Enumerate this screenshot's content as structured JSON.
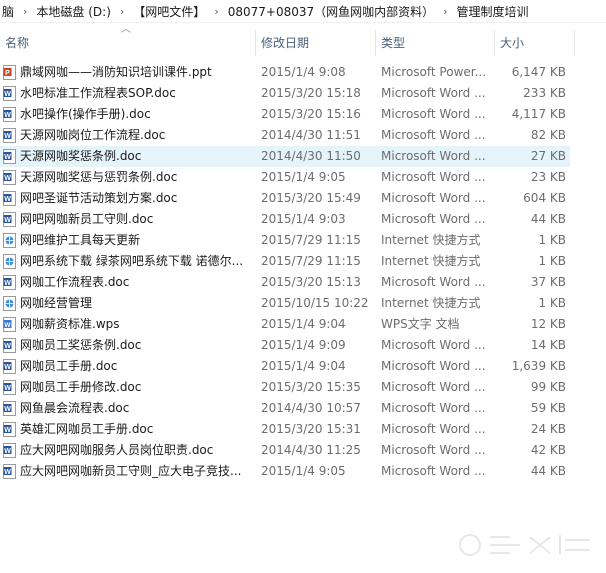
{
  "breadcrumb": [
    "脑",
    "本地磁盘 (D:)",
    "【网吧文件】",
    "08077+08037（网鱼网咖内部资料）",
    "管理制度培训"
  ],
  "columns": {
    "name": "名称",
    "date": "修改日期",
    "type": "类型",
    "size": "大小"
  },
  "colors": {
    "selected_row": "#e5f3fb",
    "header_text": "#4c607a",
    "meta_text": "#6d6d6d"
  },
  "files": [
    {
      "name": "鼎域网咖——消防知识培训课件.ppt",
      "date": "2015/1/4 9:08",
      "type": "Microsoft Power...",
      "size": "6,147 KB",
      "icon": "ppt-file-icon"
    },
    {
      "name": "水吧标准工作流程表SOP.doc",
      "date": "2015/3/20 15:18",
      "type": "Microsoft Word ...",
      "size": "233 KB",
      "icon": "word-file-icon"
    },
    {
      "name": "水吧操作(操作手册).doc",
      "date": "2015/3/20 15:16",
      "type": "Microsoft Word ...",
      "size": "4,117 KB",
      "icon": "word-file-icon"
    },
    {
      "name": "天源网咖岗位工作流程.doc",
      "date": "2014/4/30 11:51",
      "type": "Microsoft Word ...",
      "size": "82 KB",
      "icon": "word-file-icon"
    },
    {
      "name": "天源网咖奖惩条例.doc",
      "date": "2014/4/30 11:50",
      "type": "Microsoft Word ...",
      "size": "27 KB",
      "icon": "word-file-icon",
      "selected": true
    },
    {
      "name": "天源网咖奖惩与惩罚条例.doc",
      "date": "2015/1/4 9:05",
      "type": "Microsoft Word ...",
      "size": "23 KB",
      "icon": "word-file-icon"
    },
    {
      "name": "网吧圣诞节活动策划方案.doc",
      "date": "2015/3/20 15:49",
      "type": "Microsoft Word ...",
      "size": "604 KB",
      "icon": "word-file-icon"
    },
    {
      "name": "网吧网咖新员工守则.doc",
      "date": "2015/1/4 9:03",
      "type": "Microsoft Word ...",
      "size": "44 KB",
      "icon": "word-file-icon"
    },
    {
      "name": "网吧维护工具每天更新",
      "date": "2015/7/29 11:15",
      "type": "Internet 快捷方式",
      "size": "1 KB",
      "icon": "internet-shortcut-icon"
    },
    {
      "name": "网吧系统下载 绿茶网吧系统下载 诺德尔...",
      "date": "2015/7/29 11:15",
      "type": "Internet 快捷方式",
      "size": "1 KB",
      "icon": "internet-shortcut-icon"
    },
    {
      "name": "网咖工作流程表.doc",
      "date": "2015/3/20 15:13",
      "type": "Microsoft Word ...",
      "size": "37 KB",
      "icon": "word-file-icon"
    },
    {
      "name": "网咖经营管理",
      "date": "2015/10/15 10:22",
      "type": "Internet 快捷方式",
      "size": "1 KB",
      "icon": "internet-shortcut-icon"
    },
    {
      "name": "网咖薪资标准.wps",
      "date": "2015/1/4 9:04",
      "type": "WPS文字 文档",
      "size": "12 KB",
      "icon": "wps-file-icon"
    },
    {
      "name": "网咖员工奖惩条例.doc",
      "date": "2015/1/4 9:09",
      "type": "Microsoft Word ...",
      "size": "14 KB",
      "icon": "word-file-icon"
    },
    {
      "name": "网咖员工手册.doc",
      "date": "2015/1/4 9:04",
      "type": "Microsoft Word ...",
      "size": "1,639 KB",
      "icon": "word-file-icon"
    },
    {
      "name": "网咖员工手册修改.doc",
      "date": "2015/3/20 15:35",
      "type": "Microsoft Word ...",
      "size": "99 KB",
      "icon": "word-file-icon"
    },
    {
      "name": "网鱼晨会流程表.doc",
      "date": "2014/4/30 10:57",
      "type": "Microsoft Word ...",
      "size": "59 KB",
      "icon": "word-file-icon"
    },
    {
      "name": "英雄汇网咖员工手册.doc",
      "date": "2015/3/20 15:31",
      "type": "Microsoft Word ...",
      "size": "24 KB",
      "icon": "word-file-icon"
    },
    {
      "name": "应大网吧网咖服务人员岗位职责.doc",
      "date": "2014/4/30 11:25",
      "type": "Microsoft Word ...",
      "size": "42 KB",
      "icon": "word-file-icon"
    },
    {
      "name": "应大网吧网咖新员工守则_应大电子竞技...",
      "date": "2015/1/4 9:05",
      "type": "Microsoft Word ...",
      "size": "44 KB",
      "icon": "word-file-icon"
    }
  ]
}
